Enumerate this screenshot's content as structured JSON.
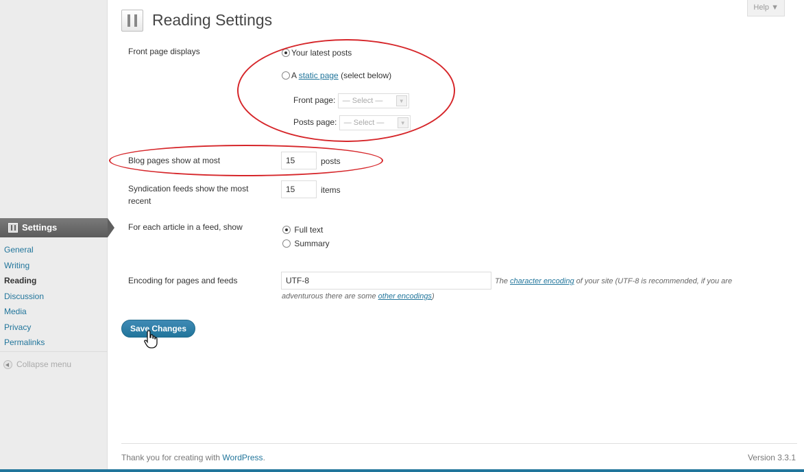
{
  "header": {
    "title": "Reading Settings",
    "help": "Help ▼"
  },
  "sidebar": {
    "section_title": "Settings",
    "items": [
      {
        "label": "General"
      },
      {
        "label": "Writing"
      },
      {
        "label": "Reading"
      },
      {
        "label": "Discussion"
      },
      {
        "label": "Media"
      },
      {
        "label": "Privacy"
      },
      {
        "label": "Permalinks"
      }
    ],
    "current_item": "Reading",
    "collapse": "Collapse menu"
  },
  "form": {
    "front_page": {
      "label": "Front page displays",
      "option_latest": "Your latest posts",
      "option_static_prefix": "A",
      "option_static_link": "static page",
      "option_static_suffix": "(select below)",
      "selected": "Your latest posts",
      "front_page_label": "Front page:",
      "posts_page_label": "Posts page:",
      "front_page_value": "— Select —",
      "posts_page_value": "— Select —"
    },
    "blog_pages": {
      "label": "Blog pages show at most",
      "value": "15",
      "unit": "posts"
    },
    "syndication": {
      "label_line1": "Syndication feeds show the most",
      "label_line2": "recent",
      "value": "15",
      "unit": "items"
    },
    "feed_article": {
      "label": "For each article in a feed, show",
      "option_full": "Full text",
      "option_summary": "Summary",
      "selected": "Full text"
    },
    "encoding": {
      "label": "Encoding for pages and feeds",
      "value": "UTF-8",
      "desc_prefix": "The",
      "desc_link1": "character encoding",
      "desc_middle": "of your site (UTF-8 is recommended, if you are",
      "desc_line2_prefix": "adventurous there are some",
      "desc_link2": "other encodings",
      "desc_end": ")"
    },
    "save_label": "Save Changes"
  },
  "footer": {
    "thanks_prefix": "Thank you for creating with",
    "wordpress": "WordPress",
    "thanks_suffix": ".",
    "version": "Version 3.3.1"
  },
  "colors": {
    "accent": "#21759b",
    "annotation": "#d6262a",
    "sidebar_bg": "#ececec"
  }
}
